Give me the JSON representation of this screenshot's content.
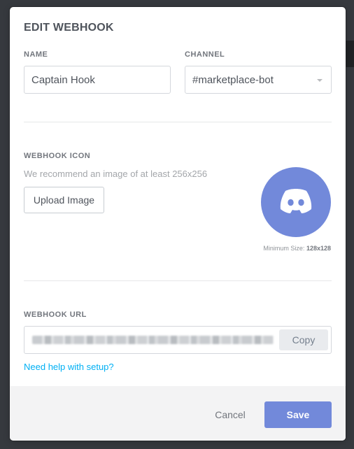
{
  "modal": {
    "title": "EDIT WEBHOOK"
  },
  "name_field": {
    "label": "NAME",
    "value": "Captain Hook"
  },
  "channel_field": {
    "label": "CHANNEL",
    "value": "#marketplace-bot"
  },
  "icon_section": {
    "label": "WEBHOOK ICON",
    "hint": "We recommend an image of at least 256x256",
    "upload_label": "Upload Image",
    "min_size_prefix": "Minimum Size:",
    "min_size_value": "128x128",
    "avatar_icon": "discord-logo-icon"
  },
  "url_section": {
    "label": "WEBHOOK URL",
    "copy_label": "Copy",
    "help_link": "Need help with setup?"
  },
  "footer": {
    "cancel_label": "Cancel",
    "save_label": "Save"
  },
  "colors": {
    "accent": "#7289da",
    "link": "#00b0f4",
    "backdrop": "#36393e"
  }
}
